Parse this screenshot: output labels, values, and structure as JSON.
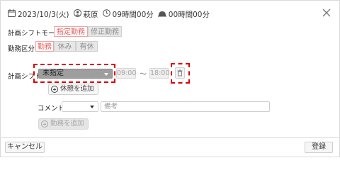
{
  "header": {
    "date": "2023/10/3(火)",
    "name": "萩原",
    "work_time": "09時間00分",
    "overtime": "00時間00分"
  },
  "plan_mode": {
    "label": "計画シフトモード",
    "options": [
      "指定勤務",
      "修正勤務"
    ],
    "selected": "指定勤務"
  },
  "work_type": {
    "label": "勤務区分",
    "options": [
      "勤務",
      "休み",
      "有休"
    ],
    "selected": "勤務"
  },
  "plan_shift": {
    "label": "計画シフト",
    "select_value": "未指定",
    "start": "09:00",
    "separator": "〜",
    "end": "18:00",
    "add_break_label": "休憩を追加"
  },
  "comment": {
    "label": "コメント",
    "memo_placeholder": "備考"
  },
  "add_work_label": "勤務を追加",
  "footer": {
    "cancel_label": "キャンセル",
    "register_label": "登録"
  },
  "colors": {
    "accent": "#e45858",
    "highlight_box": "#e00000"
  }
}
